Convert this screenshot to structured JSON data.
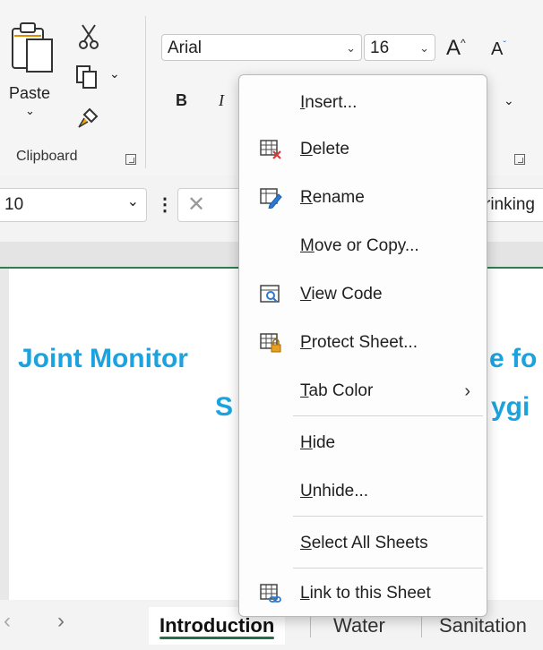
{
  "ribbon": {
    "clipboard": {
      "paste_label": "Paste",
      "group_label": "Clipboard"
    },
    "font": {
      "name": "Arial",
      "size": "16",
      "bold_label": "B",
      "italic_label": "I",
      "grow_label": "A",
      "shrink_label": "A"
    }
  },
  "formula_bar": {
    "name_box": "10",
    "content_fragment": "rinking"
  },
  "sheet": {
    "title_line1_left": "Joint Monitor",
    "title_line1_right": "e fo",
    "title_line2_left": "S",
    "title_line2_right": "ygi"
  },
  "context_menu": {
    "items": [
      {
        "before": "",
        "mnemonic": "I",
        "after": "nsert...",
        "icon": "none"
      },
      {
        "before": "",
        "mnemonic": "D",
        "after": "elete",
        "icon": "delete-sheet-icon"
      },
      {
        "before": "",
        "mnemonic": "R",
        "after": "ename",
        "icon": "rename-sheet-icon"
      },
      {
        "before": "",
        "mnemonic": "M",
        "after": "ove or Copy...",
        "icon": "none"
      },
      {
        "before": "",
        "mnemonic": "V",
        "after": "iew Code",
        "icon": "view-code-icon"
      },
      {
        "before": "",
        "mnemonic": "P",
        "after": "rotect Sheet...",
        "icon": "protect-sheet-icon"
      },
      {
        "before": "",
        "mnemonic": "T",
        "after": "ab Color",
        "icon": "none"
      },
      {
        "before": "",
        "mnemonic": "H",
        "after": "ide",
        "icon": "none"
      },
      {
        "before": "",
        "mnemonic": "U",
        "after": "nhide...",
        "icon": "none"
      },
      {
        "before": "",
        "mnemonic": "S",
        "after": "elect All Sheets",
        "icon": "none"
      },
      {
        "before": "",
        "mnemonic": "L",
        "after": "ink to this Sheet",
        "icon": "link-sheet-icon"
      }
    ]
  },
  "tabs": {
    "items": [
      "Introduction",
      "Water",
      "Sanitation"
    ],
    "active": "Introduction"
  },
  "colors": {
    "title_blue": "#1ca3de",
    "active_tab_green": "#217346"
  }
}
